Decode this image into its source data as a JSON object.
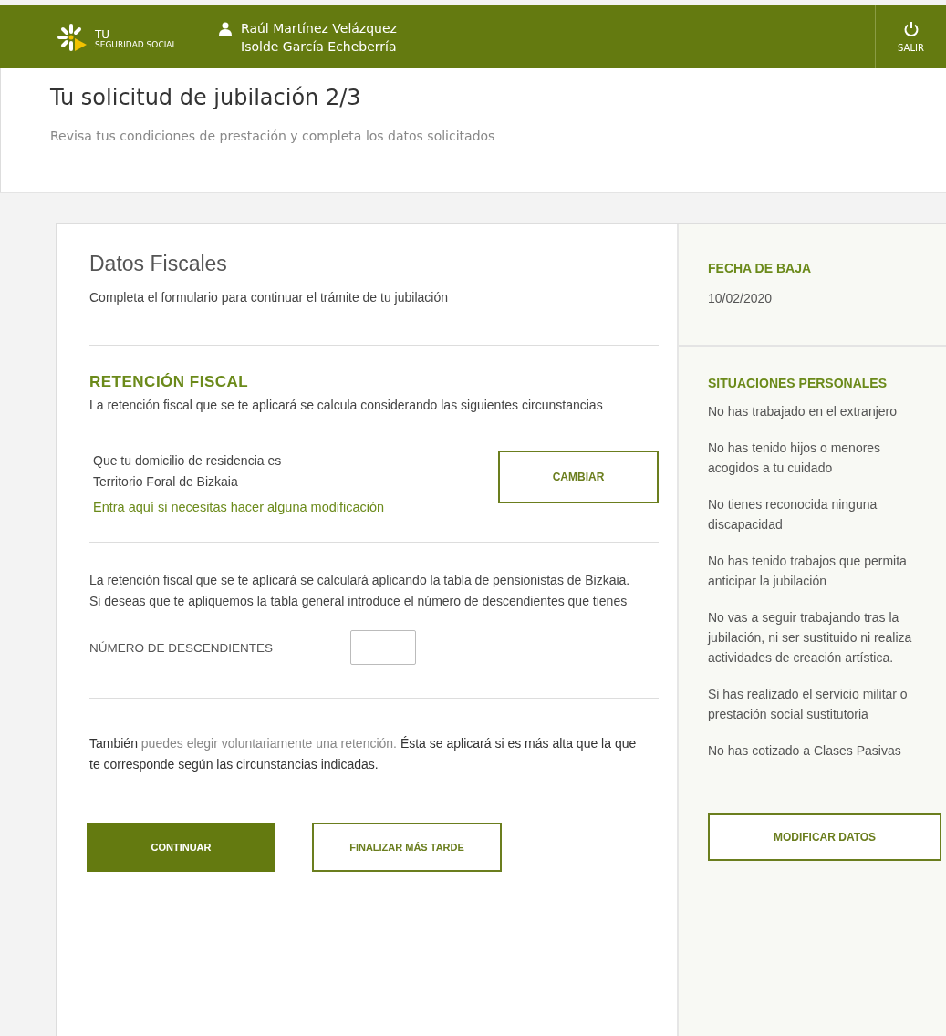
{
  "header": {
    "brand_top": "TU",
    "brand_bottom": "SEGURIDAD SOCIAL",
    "users": [
      "Raúl Martínez Velázquez",
      "Isolde García Echeberría"
    ],
    "logout": "SALIR"
  },
  "page": {
    "title": "Tu solicitud de jubilación 2/3",
    "subtitle": "Revisa tus condiciones de prestación y completa los datos solicitados"
  },
  "form": {
    "title": "Datos Fiscales",
    "intro": "Completa el formulario para continuar el trámite de tu jubilación",
    "section_title": "RETENCIÓN  FISCAL",
    "section_text": "La retención fiscal que se te aplicará se calcula considerando las siguientes circunstancias",
    "residence_lines": [
      "Que tu domicilio de residencia es",
      "Territorio Foral de Bizkaia"
    ],
    "residence_link": "Entra aquí si necesitas hacer alguna modificación",
    "change_button": "CAMBIAR",
    "table_text": "La retención fiscal que se te aplicará se calculará aplicando la tabla de pensionistas de Bizkaia. Si deseas que te apliquemos la tabla general introduce el número de descendientes que tienes",
    "descendants_label": "NÚMERO DE DESCENDIENTES",
    "voluntary_text": [
      {
        "text": "También ",
        "muted": false
      },
      {
        "text": "puedes elegir voluntariamente una retención. ",
        "muted": true
      },
      {
        "text": "Ésta se aplicará si es más alta que la que te corresponde según las circunstancias indicadas.",
        "muted": false
      }
    ],
    "buttons": [
      {
        "label": "CONTINUAR",
        "kind": "primary"
      },
      {
        "label": "FINALIZAR  MÁS  TARDE",
        "kind": "secondary"
      }
    ]
  },
  "summary": {
    "date_title": "FECHA DE BAJA",
    "date": "10/02/2020",
    "situations_title": "SITUACIONES PERSONALES",
    "situations": [
      {
        "lines": [
          "No has trabajado en el extranjero"
        ]
      },
      {
        "lines": [
          "No has tenido hijos o menores",
          "acogidos a tu cuidado"
        ]
      },
      {
        "lines": [
          "No tienes reconocida ninguna",
          "discapacidad"
        ]
      },
      {
        "lines": [
          "No has tenido trabajos que permita",
          "anticipar la jubilación"
        ]
      },
      {
        "lines": [
          "No vas a seguir trabajando tras la",
          "jubilación, ni ser sustituido ni realiza",
          "actividades de creación artística."
        ]
      },
      {
        "lines": [
          "Si has realizado el servicio militar o",
          "prestación social sustitutoria"
        ]
      },
      {
        "lines": [
          "No has cotizado a Clases Pasivas"
        ]
      }
    ],
    "modify_button": "MODIFICAR DATOS"
  }
}
